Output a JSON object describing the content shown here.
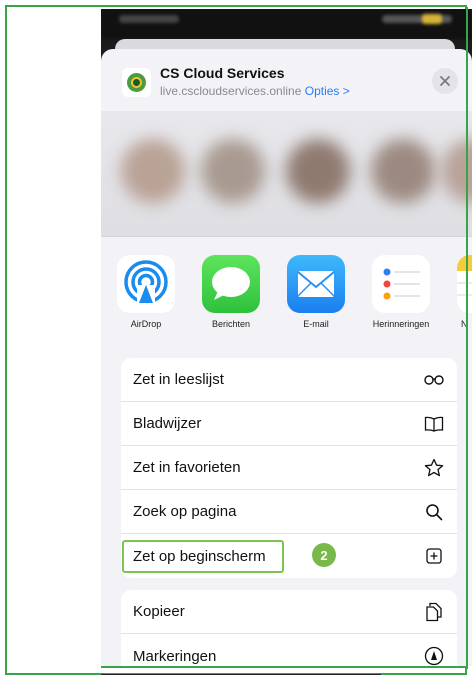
{
  "header": {
    "title": "CS Cloud Services",
    "url": "live.cscloudservices.online",
    "options_label": "Opties >"
  },
  "apps": [
    {
      "label": "AirDrop",
      "icon": "airdrop-icon"
    },
    {
      "label": "Berichten",
      "icon": "messages-icon"
    },
    {
      "label": "E-mail",
      "icon": "mail-icon"
    },
    {
      "label": "Herinneringen",
      "icon": "reminders-icon"
    },
    {
      "label": "N",
      "icon": "notes-icon"
    }
  ],
  "actions_group1": [
    {
      "label": "Zet in leeslijst",
      "icon": "glasses-icon"
    },
    {
      "label": "Bladwijzer",
      "icon": "book-icon"
    },
    {
      "label": "Zet in favorieten",
      "icon": "star-icon"
    },
    {
      "label": "Zoek op pagina",
      "icon": "search-icon"
    },
    {
      "label": "Zet op beginscherm",
      "icon": "add-square-icon"
    }
  ],
  "actions_group2": [
    {
      "label": "Kopieer",
      "icon": "copy-icon"
    },
    {
      "label": "Markeringen",
      "icon": "markup-icon"
    }
  ],
  "annotation": {
    "badge": "2"
  },
  "colors": {
    "accent_green": "#3aa34a",
    "highlight_green": "#7cc34f",
    "link_blue": "#2f7df6",
    "sheet_bg": "#f2f2f7"
  }
}
